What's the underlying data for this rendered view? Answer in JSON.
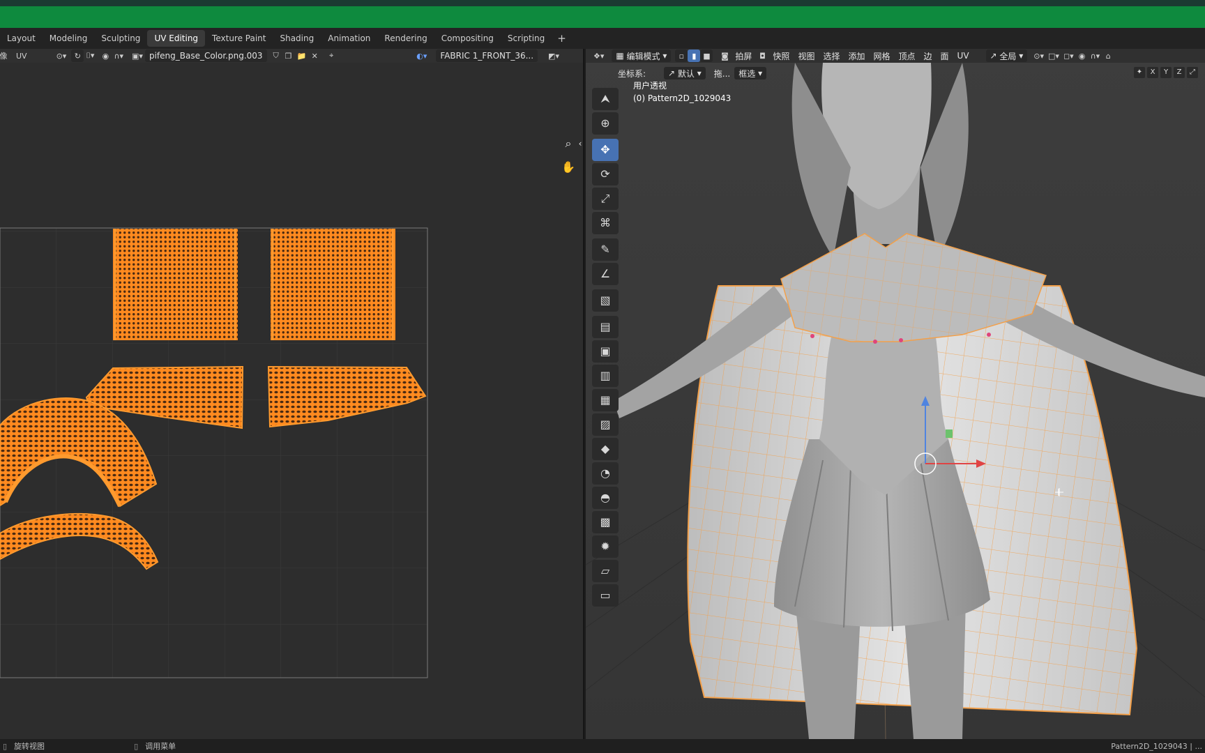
{
  "workspace_tabs": [
    "Layout",
    "Modeling",
    "Sculpting",
    "UV Editing",
    "Texture Paint",
    "Shading",
    "Animation",
    "Rendering",
    "Compositing",
    "Scripting"
  ],
  "workspace_add": "+",
  "uv_editor": {
    "mode_char": "像",
    "menu_uv": "UV",
    "image_name": "pifeng_Base_Color.png.003",
    "uv_map_name": "FABRIC 1_FRONT_36...",
    "zoom_icon": "⌕",
    "pan_icon": "✋",
    "collapse_icon": "‹"
  },
  "viewport": {
    "mode": "编辑模式",
    "screenshot_btn": "拍屏",
    "snapshot_btn": "快照",
    "menus": [
      "视图",
      "选择",
      "添加",
      "网格",
      "顶点",
      "边",
      "面",
      "UV"
    ],
    "global_label": "全局",
    "coord_label": "坐标系:",
    "coord_value": "默认",
    "drag_label": "拖...",
    "drag_value": "框选",
    "view_name": "用户透视",
    "object_name": "(0) Pattern2D_1029043",
    "axes": [
      "X",
      "Y",
      "Z"
    ]
  },
  "status_bar": {
    "left": "旋转视图",
    "middle": "调用菜单",
    "right": "Pattern2D_1029043 | ..."
  },
  "colors": {
    "title_green": "#0e8a3e",
    "accent_blue": "#4772b3",
    "uv_orange": "#ff8a1f",
    "wire_orange": "#f3a04a"
  }
}
